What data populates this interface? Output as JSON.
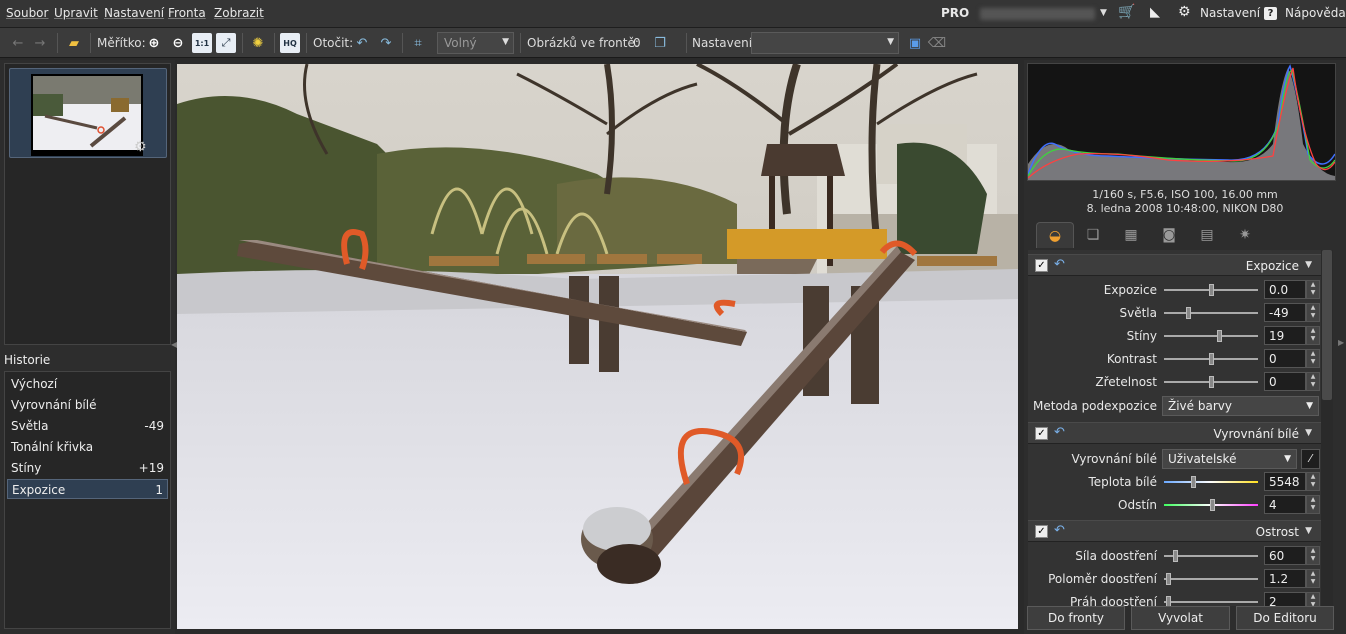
{
  "menu": {
    "items": [
      "Soubor",
      "Upravit",
      "Nastavení",
      "Fronta",
      "Zobrazit"
    ],
    "pro_label": "PRO",
    "settings_label": "Nastavení",
    "help_label": "Nápověda"
  },
  "toolbar": {
    "scale_label": "Měřítko:",
    "rotate_label": "Otočit:",
    "crop_mode": "Volný",
    "queue_label": "Obrázků ve frontě:",
    "queue_count": "0",
    "preset_label": "Nastavení:",
    "preset_value": "",
    "zoom_1to1": "1:1",
    "hq": "HQ"
  },
  "history": {
    "title": "Historie",
    "items": [
      {
        "label": "Výchozí",
        "value": ""
      },
      {
        "label": "Vyrovnání bílé",
        "value": ""
      },
      {
        "label": "Světla",
        "value": "-49"
      },
      {
        "label": "Tonální křivka",
        "value": ""
      },
      {
        "label": "Stíny",
        "value": "+19"
      },
      {
        "label": "Expozice",
        "value": "1"
      }
    ],
    "selected_index": 5
  },
  "exif": {
    "line1": "1/160 s, F5.6, ISO 100, 16.00 mm",
    "line2": "8. ledna 2008 10:48:00, NIKON D80"
  },
  "panels": {
    "exposure": {
      "title": "Expozice",
      "rows": [
        {
          "label": "Expozice",
          "value": "0.0",
          "level": 0.5
        },
        {
          "label": "Světla",
          "value": "-49",
          "level": 0.25
        },
        {
          "label": "Stíny",
          "value": "19",
          "level": 0.6
        },
        {
          "label": "Kontrast",
          "value": "0",
          "level": 0.5
        },
        {
          "label": "Zřetelnost",
          "value": "0",
          "level": 0.5
        }
      ],
      "method_label": "Metoda podexpozice",
      "method_value": "Živé barvy"
    },
    "white_balance": {
      "title": "Vyrovnání bílé",
      "mode_label": "Vyrovnání bílé",
      "mode_value": "Uživatelské",
      "rows": [
        {
          "label": "Teplota bílé",
          "value": "5548",
          "level": 0.3
        },
        {
          "label": "Odstín",
          "value": "4",
          "level": 0.52
        }
      ]
    },
    "sharpen": {
      "title": "Ostrost",
      "rows": [
        {
          "label": "Síla doostření",
          "value": "60",
          "level": 0.1
        },
        {
          "label": "Poloměr doostření",
          "value": "1.2",
          "level": 0.02
        },
        {
          "label": "Práh doostření",
          "value": "2",
          "level": 0.02
        }
      ]
    }
  },
  "buttons": {
    "queue": "Do fronty",
    "develop": "Vyvolat",
    "editor": "Do Editoru"
  }
}
